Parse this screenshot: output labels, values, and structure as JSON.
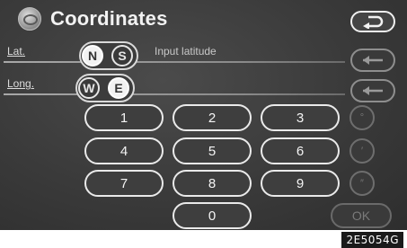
{
  "screen": {
    "title": "Coordinates",
    "latitude": {
      "label": "Lat.",
      "hint": "Input latitude",
      "options": [
        {
          "label": "N",
          "selected": true
        },
        {
          "label": "S",
          "selected": false
        }
      ]
    },
    "longitude": {
      "label": "Long.",
      "options": [
        {
          "label": "W",
          "selected": false
        },
        {
          "label": "E",
          "selected": true
        }
      ]
    },
    "keypad": {
      "keys": [
        "1",
        "2",
        "3",
        "4",
        "5",
        "6",
        "7",
        "8",
        "9",
        "0"
      ],
      "symbols": [
        "°",
        "′",
        "″"
      ],
      "ok_label": "OK"
    }
  },
  "caption": "2E5054G",
  "icons": {
    "back": "u-turn-back-arrow-icon",
    "delete": "left-arrow-icon",
    "logo": "brand-logo-icon"
  }
}
